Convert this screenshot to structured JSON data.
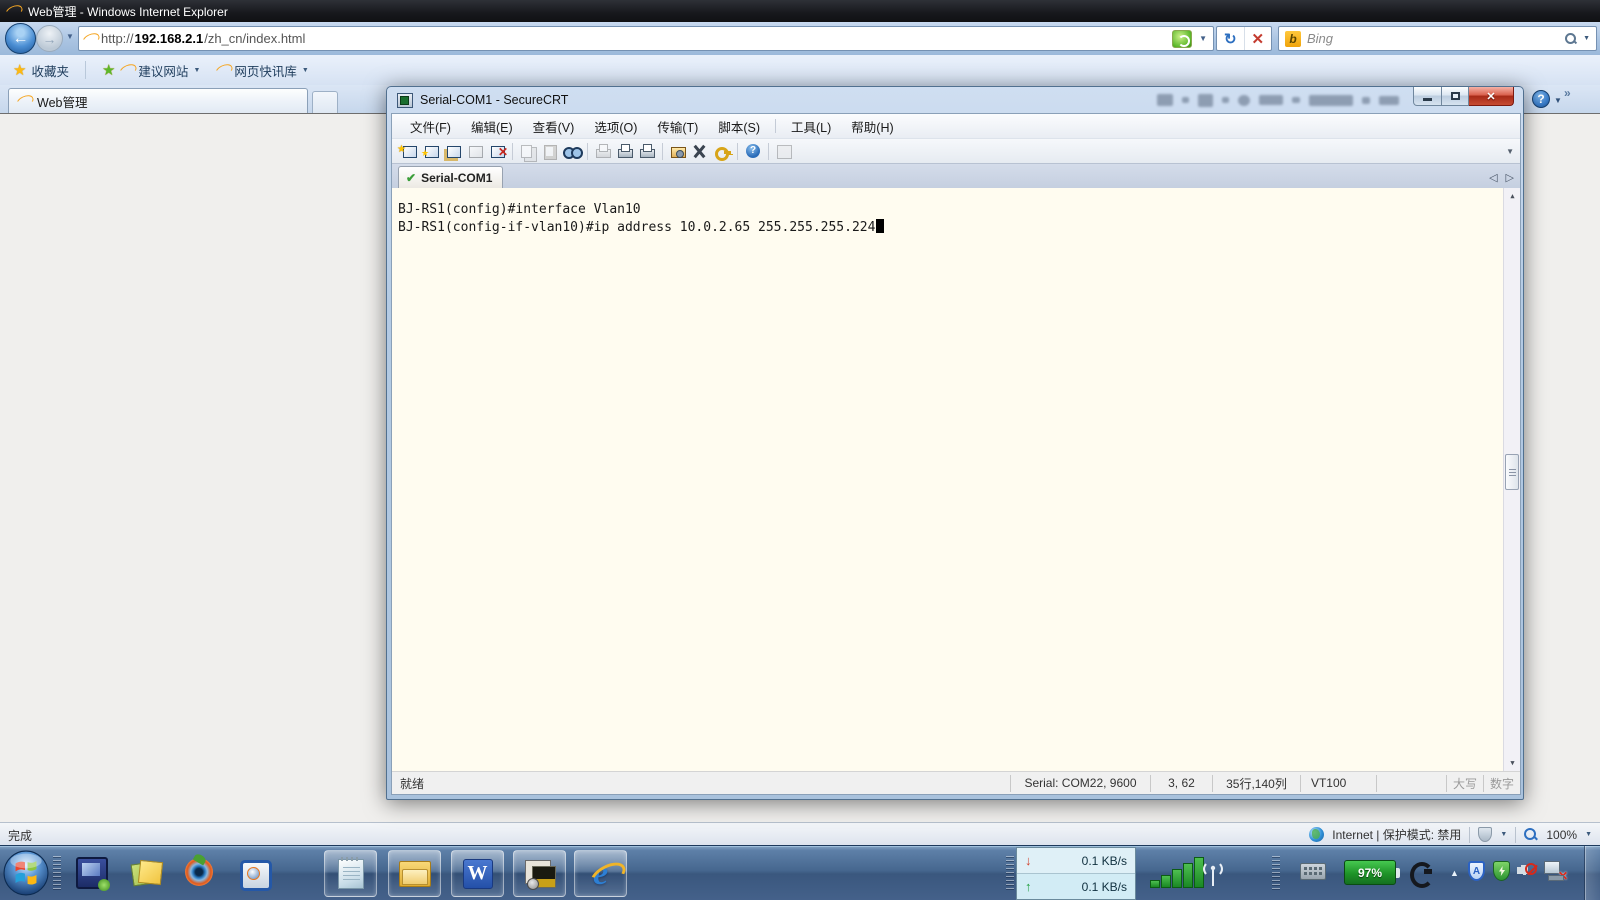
{
  "ie": {
    "window_title": "Web管理 - Windows Internet Explorer",
    "address_prefix": "http://",
    "address_host": "192.168.2.1",
    "address_path": "/zh_cn/index.html",
    "search_placeholder": "Bing",
    "search_logo_letter": "b",
    "favorites_label": "收藏夹",
    "suggested_sites_label": "建议网站",
    "web_slices_label": "网页快讯库",
    "tab_title": "Web管理",
    "status_left": "完成",
    "status_zone": "Internet | 保护模式: 禁用",
    "zoom_level": "100%"
  },
  "crt": {
    "window_title": "Serial-COM1 - SecureCRT",
    "menus": [
      "文件(F)",
      "编辑(E)",
      "查看(V)",
      "选项(O)",
      "传输(T)",
      "脚本(S)",
      "工具(L)",
      "帮助(H)"
    ],
    "tab_label": "Serial-COM1",
    "terminal": {
      "line1": "BJ-RS1(config)#interface Vlan10",
      "line2": "BJ-RS1(config-if-vlan10)#ip address 10.0.2.65 255.255.255.224"
    },
    "status_ready": "就绪",
    "status_serial": "Serial: COM22, 9600",
    "status_cursor": "3, 62",
    "status_size": "35行,140列",
    "status_emulation": "VT100",
    "status_caps": "大写",
    "status_num": "数字"
  },
  "taskbar": {
    "download_speed": "0.1 KB/s",
    "upload_speed": "0.1 KB/s",
    "battery_level": "97%",
    "word_letter": "W"
  },
  "glyphs": {
    "dropdown": "▼",
    "back_arrow": "←",
    "forward_arrow": "→",
    "close": "✕",
    "refresh": "↻",
    "stop": "✕",
    "star": "★",
    "check": "✔",
    "tab_prev": "◁",
    "tab_next": "▷",
    "overflow_down": "▼",
    "scroll_up": "▲",
    "scroll_down": "▼",
    "help": "?",
    "more_chevron": "»",
    "down_arrow": "↓",
    "up_arrow": "↑",
    "tray_up": "▲"
  },
  "colors": {
    "terminal_bg": "#fffcf0",
    "battery_green": "#1e9428",
    "taskbar_blue": "#46678f",
    "close_red": "#a72a18"
  }
}
